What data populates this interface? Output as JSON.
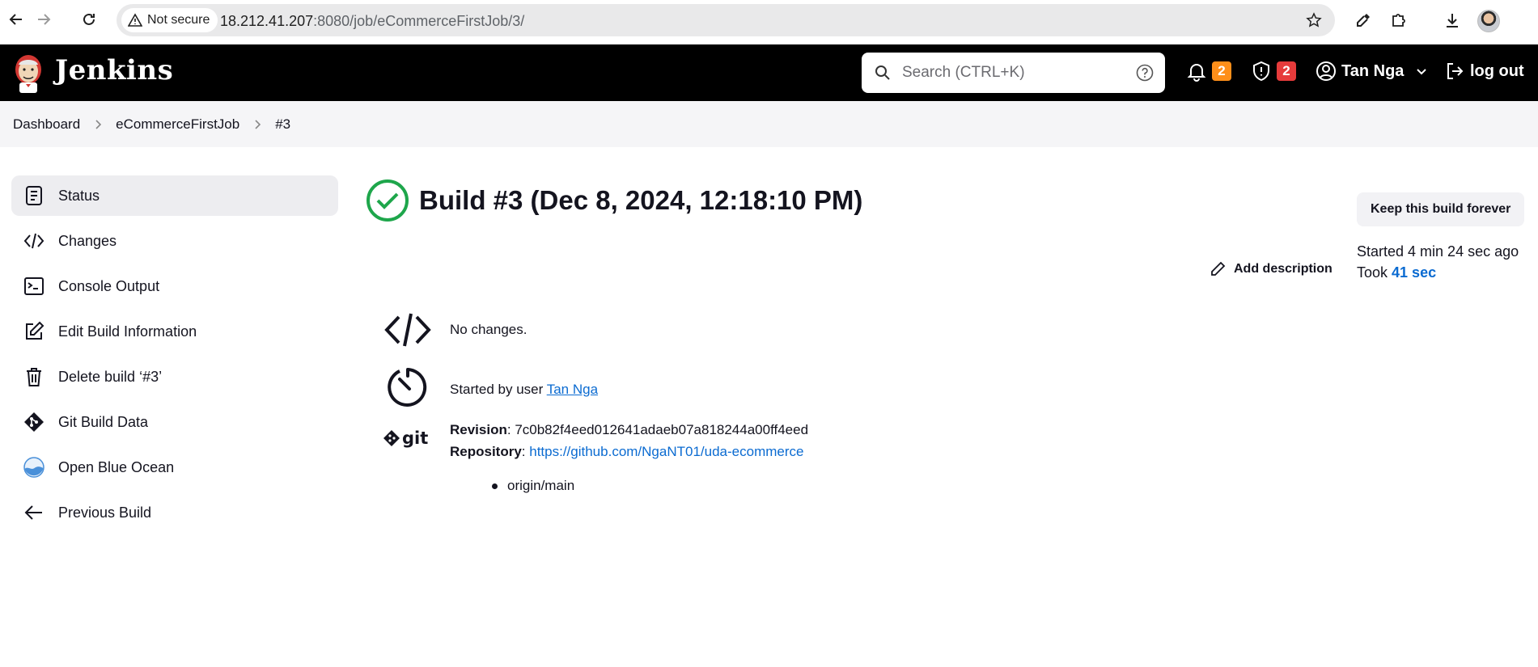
{
  "browser": {
    "security_label": "Not secure",
    "url_host": "18.212.41.207",
    "url_rest": ":8080/job/eCommerceFirstJob/3/"
  },
  "header": {
    "brand": "Jenkins",
    "search_placeholder": "Search (CTRL+K)",
    "notifications_count": "2",
    "security_count": "2",
    "user_name": "Tan Nga",
    "logout_label": "log out"
  },
  "breadcrumb": {
    "items": [
      "Dashboard",
      "eCommerceFirstJob",
      "#3"
    ]
  },
  "sidebar": {
    "items": [
      {
        "label": "Status",
        "icon": "status-icon"
      },
      {
        "label": "Changes",
        "icon": "code-icon"
      },
      {
        "label": "Console Output",
        "icon": "terminal-icon"
      },
      {
        "label": "Edit Build Information",
        "icon": "edit-icon"
      },
      {
        "label": "Delete build ‘#3’",
        "icon": "trash-icon"
      },
      {
        "label": "Git Build Data",
        "icon": "git-icon"
      },
      {
        "label": "Open Blue Ocean",
        "icon": "blue-ocean-icon"
      },
      {
        "label": "Previous Build",
        "icon": "arrow-left-icon"
      }
    ]
  },
  "build": {
    "title": "Build #3 (Dec 8, 2024, 12:18:10 PM)",
    "keep_label": "Keep this build forever",
    "started_ago": "Started 4 min 24 sec ago",
    "took_prefix": "Took ",
    "took_value": "41 sec",
    "add_description": "Add description",
    "no_changes": "No changes.",
    "started_by_prefix": "Started by user ",
    "started_by_user": "Tan Nga",
    "revision_label": "Revision",
    "revision_value": "7c0b82f4eed012641adaeb07a818244a00ff4eed",
    "repository_label": "Repository",
    "repository_url": "https://github.com/NgaNT01/uda-ecommerce",
    "branch": "origin/main"
  },
  "colors": {
    "success": "#1ea64b",
    "link": "#0b6bd1",
    "header_bg": "#000000"
  }
}
